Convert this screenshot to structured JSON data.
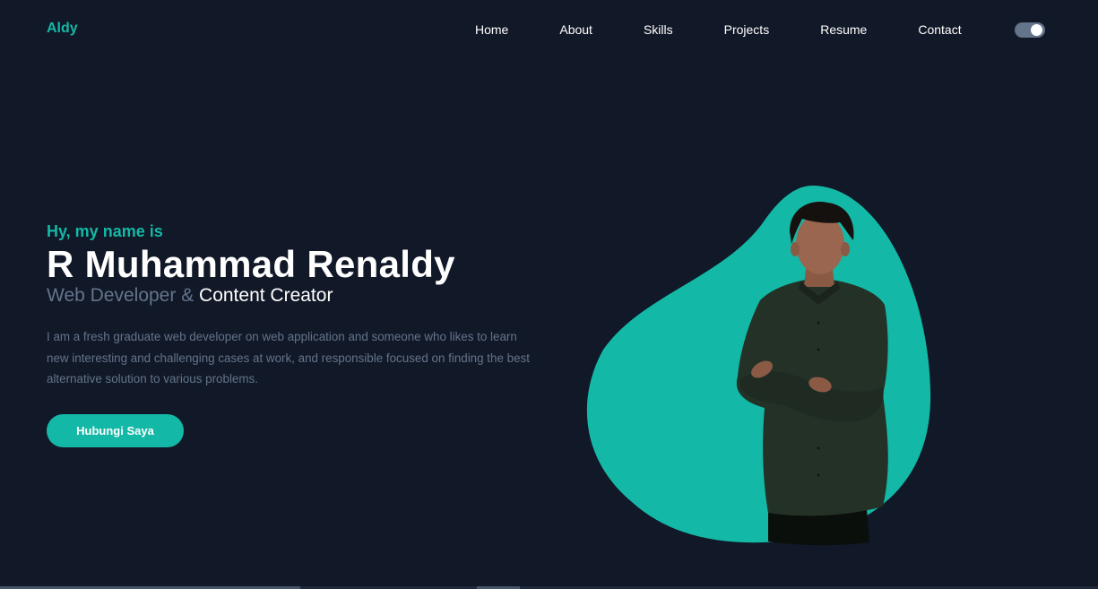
{
  "header": {
    "brand": "Aldy",
    "nav": [
      {
        "label": "Home"
      },
      {
        "label": "About"
      },
      {
        "label": "Skills"
      },
      {
        "label": "Projects"
      },
      {
        "label": "Resume"
      },
      {
        "label": "Contact"
      }
    ]
  },
  "hero": {
    "greeting": "Hy, my name is",
    "name": "R Muhammad Renaldy",
    "role_primary": "Web Developer & ",
    "role_secondary": "Content Creator",
    "description": "I am a fresh graduate web developer on web application and someone who likes to learn new interesting and challenging cases at work, and responsible focused on finding the best alternative solution to various problems.",
    "cta_label": "Hubungi Saya"
  },
  "colors": {
    "background": "#111827",
    "accent": "#14b8a6",
    "muted_text": "#64748b",
    "text": "#ffffff"
  },
  "icons": {
    "theme_toggle": "theme-toggle-icon",
    "portrait": "profile-photo"
  }
}
